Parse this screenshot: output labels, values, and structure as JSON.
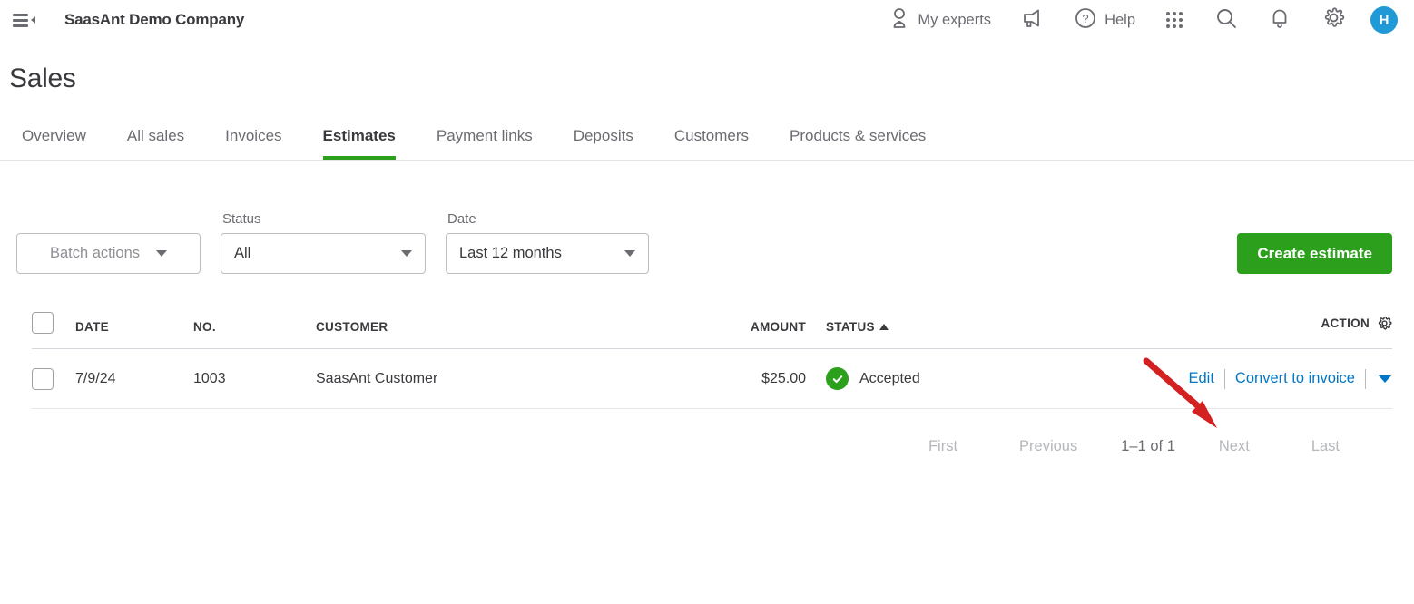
{
  "topbar": {
    "menu_icon": "hamburger-collapse-icon",
    "company": "SaasAnt Demo Company",
    "my_experts_label": "My experts",
    "my_experts_icon": "person-expert-icon",
    "announcement_icon": "megaphone-icon",
    "help_label": "Help",
    "help_icon": "question-circle-icon",
    "apps_icon": "grid-apps-icon",
    "search_icon": "search-icon",
    "notifications_icon": "bell-icon",
    "settings_icon": "gear-icon",
    "avatar_initial": "H"
  },
  "page": {
    "title": "Sales"
  },
  "tabs": [
    {
      "label": "Overview",
      "active": false
    },
    {
      "label": "All sales",
      "active": false
    },
    {
      "label": "Invoices",
      "active": false
    },
    {
      "label": "Estimates",
      "active": true
    },
    {
      "label": "Payment links",
      "active": false
    },
    {
      "label": "Deposits",
      "active": false
    },
    {
      "label": "Customers",
      "active": false
    },
    {
      "label": "Products & services",
      "active": false
    }
  ],
  "filters": {
    "batch_actions_label": "Batch actions",
    "status_label": "Status",
    "status_value": "All",
    "date_label": "Date",
    "date_value": "Last 12 months",
    "create_button": "Create estimate"
  },
  "table": {
    "headers": {
      "date": "DATE",
      "no": "NO.",
      "customer": "CUSTOMER",
      "amount": "AMOUNT",
      "status": "STATUS",
      "action": "ACTION"
    },
    "sort_column": "STATUS",
    "sort_direction": "ascending",
    "rows": [
      {
        "date": "7/9/24",
        "no": "1003",
        "customer": "SaasAnt Customer",
        "amount": "$25.00",
        "status": "Accepted",
        "status_color": "#2CA01C",
        "action_edit": "Edit",
        "action_convert": "Convert to invoice"
      }
    ]
  },
  "pagination": {
    "first": "First",
    "previous": "Previous",
    "count": "1–1 of 1",
    "next": "Next",
    "last": "Last"
  },
  "annotation": {
    "type": "red-arrow",
    "color": "#D32020",
    "points_to": "Convert to invoice"
  },
  "colors": {
    "brand_green": "#2CA01C",
    "link_blue": "#0077C5",
    "avatar_blue": "#1F9AD6",
    "text": "#393A3D",
    "muted": "#6B6C72"
  }
}
